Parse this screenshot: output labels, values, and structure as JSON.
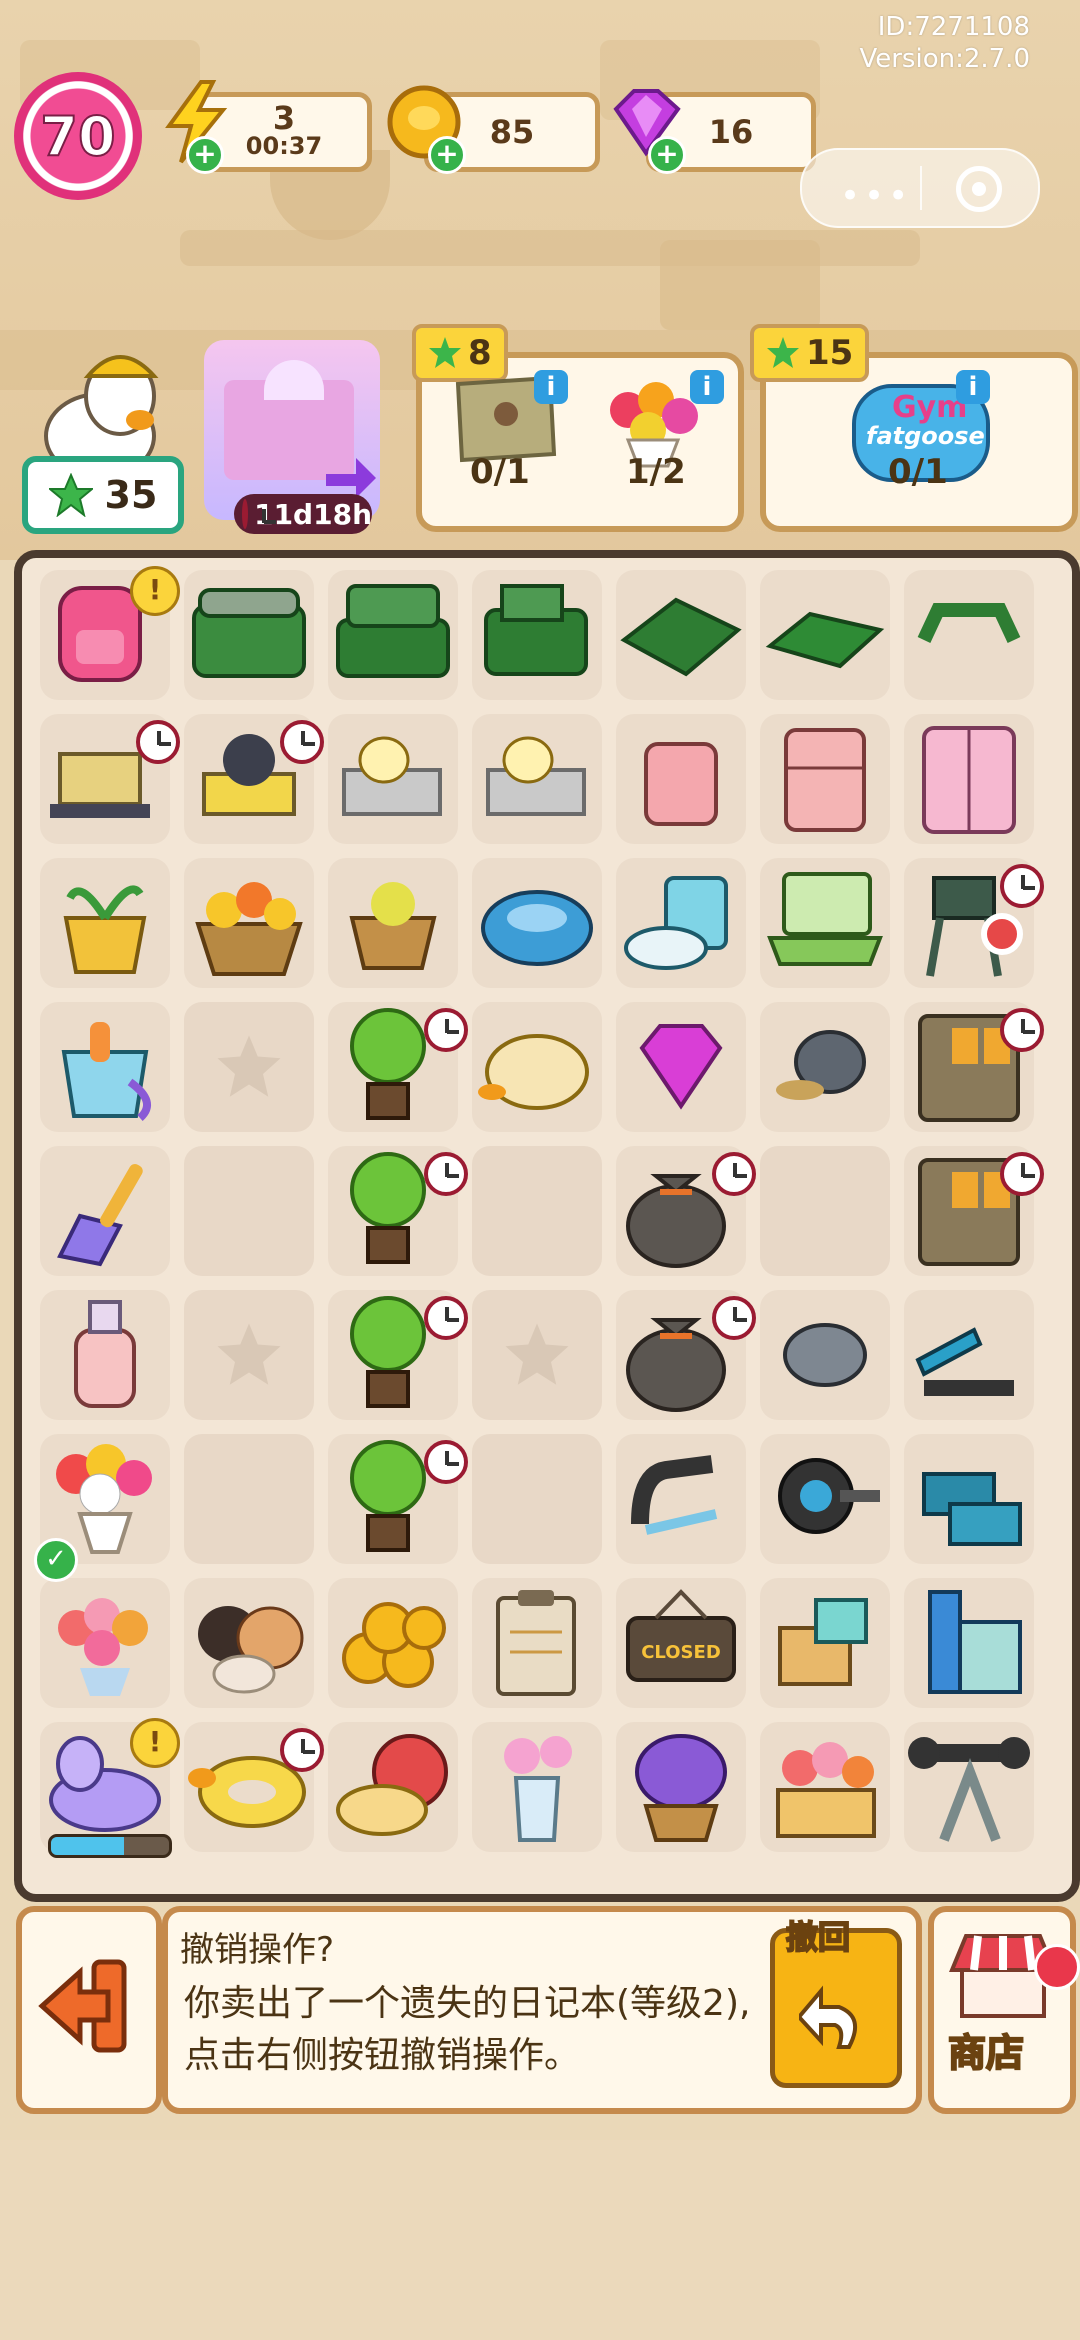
{
  "meta": {
    "id": "ID:7271108",
    "version": "Version:2.7.0"
  },
  "player": {
    "level": "70"
  },
  "resources": {
    "energy": {
      "value": "3",
      "timer": "00:37"
    },
    "coins": {
      "value": "85"
    },
    "gems": {
      "value": "16"
    }
  },
  "character": {
    "stars": "35"
  },
  "event": {
    "timer": "11d18h"
  },
  "orders": [
    {
      "reward": "8",
      "items": [
        {
          "count": "0/1"
        },
        {
          "count": "1/2"
        }
      ]
    },
    {
      "reward": "15",
      "items": [
        {
          "count": "0/1"
        }
      ],
      "gym_sign": [
        "Gym",
        "fatgoose"
      ]
    }
  ],
  "board": {
    "rows": [
      [
        "backpack-item",
        "toolbox-closed",
        "toolbox-open-a",
        "toolbox-open-b",
        "toolbox-tray",
        "toolbox-lid",
        "handle"
      ],
      [
        "cart-boxes",
        "cart-gear",
        "cart-duck",
        "cart-duck",
        "fridge-small",
        "fridge-medium",
        "fridge-large"
      ],
      [
        "sprout-pot",
        "flower-basket-large",
        "flower-basket-small",
        "robot-vacuum",
        "robot-vacuum-dock",
        "laptop",
        "high-chair"
      ],
      [
        "sand-bucket",
        "empty",
        "tree-pot",
        "sleeping-duck",
        "gem",
        "snail",
        "locker"
      ],
      [
        "dustpan",
        "empty-plain",
        "tree-pot",
        "empty-plain",
        "money-bag",
        "empty-plain",
        "locker"
      ],
      [
        "lotion-bottle",
        "empty",
        "tree-pot",
        "empty",
        "money-bag",
        "shell",
        "ab-bench"
      ],
      [
        "flower-vase-bouquet",
        "empty-plain",
        "tree-pot",
        "empty-plain",
        "hand-grip",
        "ab-roller",
        "yoga-blocks"
      ],
      [
        "tulip-bouquet",
        "hamsters",
        "coin-pile",
        "clipboard",
        "closed-sign",
        "parcel-boxes",
        "building"
      ],
      [
        "unicorn-float",
        "duck-float",
        "snail-pillow",
        "glass-vase",
        "lavender-basket",
        "flower-crate",
        "weight-bench"
      ]
    ],
    "closed_sign_text": "CLOSED"
  },
  "message": {
    "title": "撤销操作?",
    "body": "你卖出了一个遗失的日记本(等级2),点击右侧按钮撤销操作。",
    "undo_label": "撤回"
  },
  "shop": {
    "label": "商店"
  },
  "colors": {
    "accent": "#c79a58",
    "board_border": "#4a3a2e",
    "level": "#f14c93",
    "star": "#3cb54a",
    "timer_ring": "#9b1b32"
  }
}
